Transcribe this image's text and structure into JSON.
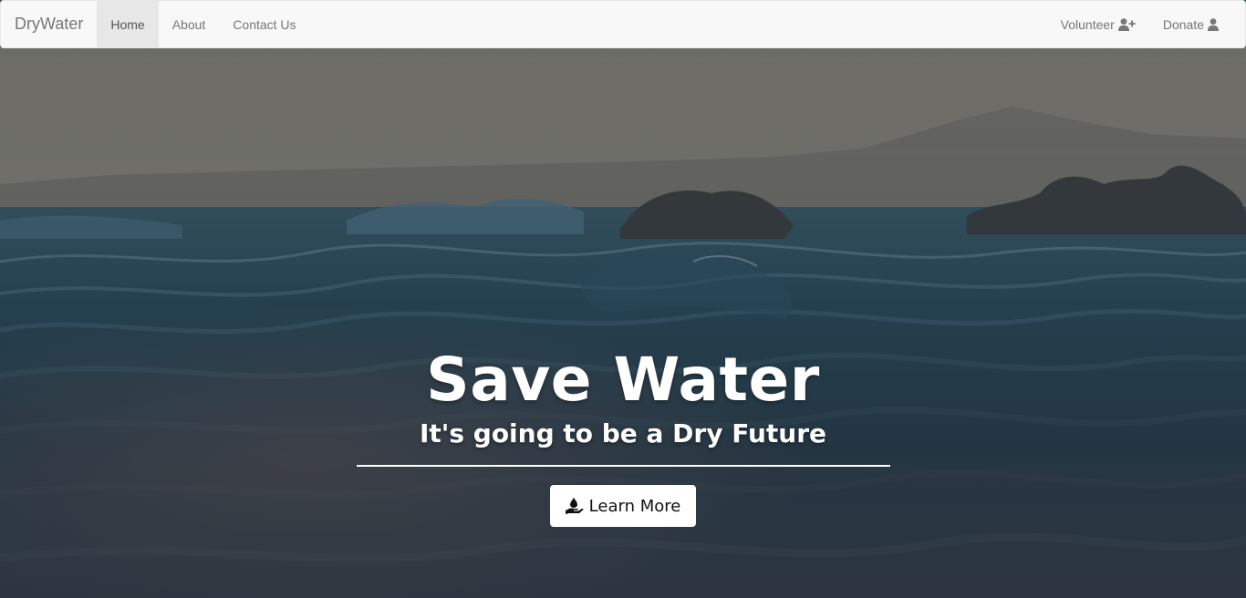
{
  "navbar": {
    "brand": "DryWater",
    "left_items": [
      {
        "label": "Home",
        "active": true
      },
      {
        "label": "About",
        "active": false
      },
      {
        "label": "Contact Us",
        "active": false
      }
    ],
    "right_items": [
      {
        "label": "Volunteer",
        "icon": "user-plus-icon"
      },
      {
        "label": "Donate",
        "icon": "user-icon"
      }
    ]
  },
  "hero": {
    "title": "Save Water",
    "subtitle": "It's going to be a Dry Future",
    "button_label": "Learn More",
    "button_icon": "hand-holding-water-icon",
    "background": "ocean-waves-photo"
  },
  "colors": {
    "navbar_bg": "#f8f8f8",
    "nav_text": "#777777",
    "active_bg": "#e7e7e7",
    "hero_text": "#ffffff",
    "water_dark": "#1f3a4c",
    "sky": "#8a8478"
  }
}
